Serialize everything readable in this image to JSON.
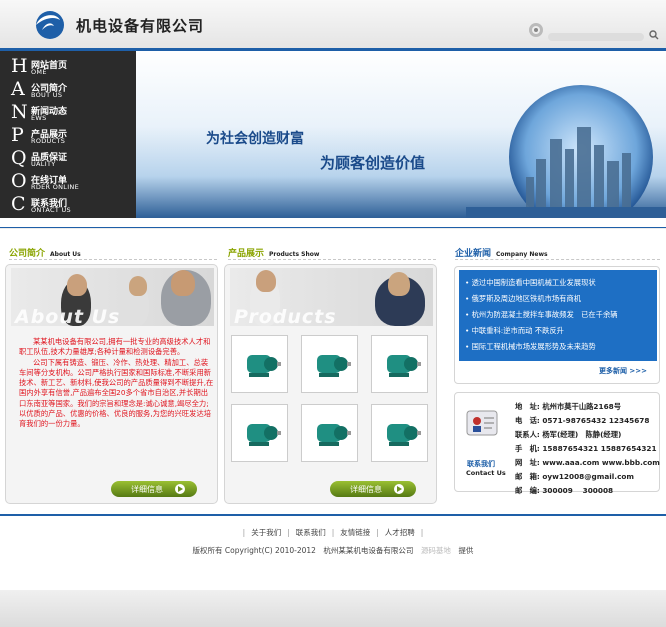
{
  "header": {
    "site_title": "机电设备有限公司"
  },
  "nav": [
    {
      "letter": "H",
      "zh": "网站首页",
      "en": "OME"
    },
    {
      "letter": "A",
      "zh": "公司简介",
      "en": "BOUT US"
    },
    {
      "letter": "N",
      "zh": "新闻动态",
      "en": "EWS"
    },
    {
      "letter": "P",
      "zh": "产品展示",
      "en": "RODUCTS"
    },
    {
      "letter": "Q",
      "zh": "品质保证",
      "en": "UALITY"
    },
    {
      "letter": "O",
      "zh": "在线订单",
      "en": "RDER ONLINE"
    },
    {
      "letter": "C",
      "zh": "联系我们",
      "en": "ONTACT US"
    }
  ],
  "banner": {
    "slogan1": "为社会创造财富",
    "slogan2": "为顾客创造价值"
  },
  "about": {
    "title_zh": "公司简介",
    "title_en": "About Us",
    "photo_caption": "About Us",
    "para1": "某某机电设备有限公司,拥有一批专业的高级技术人才和职工队伍,技术力量雄厚;各种计量和检测设备完善。",
    "para2": "公司下属有铸造、锻压、冷作、热处理、精加工、总装车间等分支机构。公司严格执行国家和国际标准,不断采用新技术、新工艺、新材料,使我公司的产品质量得到不断提升,在国内外享有信誉,产品遍布全国20多个省市自治区,并长期出口东南亚等国家。我们的宗旨和理念是:诚心诚意,竭尽全力;以优质的产品、优惠的价格、优良的服务,为您的兴旺发达培育我们的一份力量。",
    "more": "详细信息"
  },
  "products": {
    "title_zh": "产品展示",
    "title_en": "Products Show",
    "photo_caption": "Products",
    "more": "详细信息"
  },
  "news": {
    "title_zh": "企业新闻",
    "title_en": "Company News",
    "items": [
      "透过中国制造看中国机械工业发展现状",
      "俄罗斯及周边地区铁机市场有商机",
      "杭州为防混凝土搅拌车事故频发　已在千余辆",
      "中联重科:逆市而动 不跌反升",
      "国际工程机械市场发展形势及未来趋势"
    ],
    "more": "更多新闻 >>>"
  },
  "contact": {
    "label_zh": "联系我们",
    "label_en": "Contact Us",
    "lines": [
      "地　址: 杭州市莫干山路2168号",
      "电　话: 0571-98765432 12345678",
      "联系人: 杨军(经理)　陈静(经理)",
      "手　机: 15887654321 15887654321",
      "网　址: www.aaa.com www.bbb.com",
      "邮　箱: oyw12008@gmail.com",
      "邮　编: 300009　 300008"
    ]
  },
  "footer": {
    "links": [
      "关于我们",
      "联系我们",
      "友情链接",
      "人才招聘"
    ],
    "copy_prefix": "版权所有 Copyright(C) 2010-2012　杭州某某机电设备有限公司",
    "copy_mid": "源码基地",
    "copy_suffix": "提供"
  }
}
